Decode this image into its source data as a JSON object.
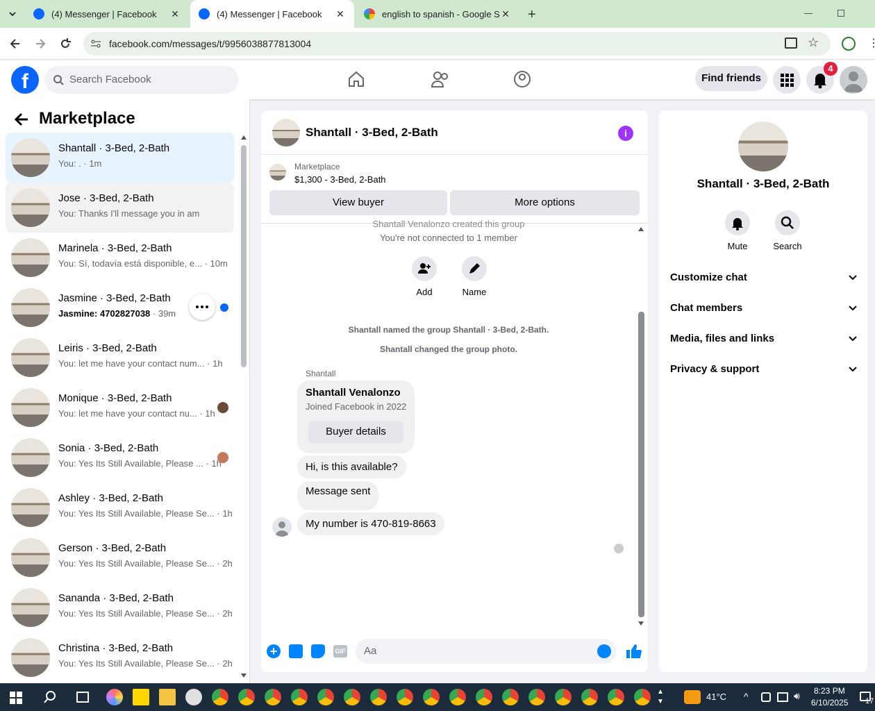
{
  "browser": {
    "tabs": [
      {
        "title": "(4) Messenger | Facebook",
        "active": false
      },
      {
        "title": "(4) Messenger | Facebook",
        "active": true
      },
      {
        "title": "english to spanish - Google Sea",
        "active": false
      }
    ],
    "url": "facebook.com/messages/t/9956038877813004"
  },
  "fb_header": {
    "search_placeholder": "Search Facebook",
    "find_friends": "Find friends",
    "notification_count": "4"
  },
  "sidebar": {
    "title": "Marketplace",
    "conversations": [
      {
        "name": "Shantall · 3-Bed, 2-Bath",
        "preview": "You: . · 1m",
        "selected": true
      },
      {
        "name": "Jose · 3-Bed, 2-Bath",
        "preview": "You: Thanks I'll message you in a",
        "time": "m"
      },
      {
        "name": "Marinela · 3-Bed, 2-Bath",
        "preview": "You: Sí, todavía está disponible, e...",
        "time": " · 10m"
      },
      {
        "name": "Jasmine · 3-Bed, 2-Bath",
        "preview": "Jasmine: 4702827038",
        "time": " · 39m",
        "unread": true
      },
      {
        "name": "Leiris · 3-Bed, 2-Bath",
        "preview": "You: let me have your contact num...",
        "time": " · 1h"
      },
      {
        "name": "Monique · 3-Bed, 2-Bath",
        "preview": "You: let me have your contact nu...",
        "time": " · 1h"
      },
      {
        "name": "Sonia · 3-Bed, 2-Bath",
        "preview": "You: Yes Its Still Available, Please ...",
        "time": " · 1h"
      },
      {
        "name": "Ashley · 3-Bed, 2-Bath",
        "preview": "You: Yes Its Still Available, Please Se...",
        "time": " · 1h"
      },
      {
        "name": "Gerson · 3-Bed, 2-Bath",
        "preview": "You: Yes Its Still Available, Please Se...",
        "time": " · 2h"
      },
      {
        "name": "Sananda · 3-Bed, 2-Bath",
        "preview": "You: Yes Its Still Available, Please Se...",
        "time": " · 2h"
      },
      {
        "name": "Christina · 3-Bed, 2-Bath",
        "preview": "You: Yes Its Still Available, Please Se...",
        "time": " · 2h"
      }
    ]
  },
  "chat": {
    "title": "Shantall · 3-Bed, 2-Bath",
    "listing_label": "Marketplace",
    "listing_detail": "$1,300 - 3-Bed, 2-Bath",
    "view_buyer": "View buyer",
    "more_options": "More options",
    "created_note": "Shantall Venalonzo created this group",
    "not_connected": "You're not connected to 1 member",
    "add_label": "Add",
    "name_label": "Name",
    "named_note": "Shantall named the group Shantall · 3-Bed, 2-Bath.",
    "photo_note": "Shantall changed the group photo.",
    "sender": "Shantall",
    "card_name": "Shantall Venalonzo",
    "card_joined": "Joined Facebook in 2022",
    "buyer_details": "Buyer details",
    "messages": [
      "Hi, is this available?",
      "Message sent",
      "My number is 470-819-8663"
    ],
    "composer_placeholder": "Aa"
  },
  "info_panel": {
    "title": "Shantall · 3-Bed, 2-Bath",
    "mute": "Mute",
    "search": "Search",
    "sections": [
      "Customize chat",
      "Chat members",
      "Media, files and links",
      "Privacy & support"
    ]
  },
  "taskbar": {
    "temperature": "41°C",
    "time": "8:23 PM",
    "date": "6/10/2025",
    "badge": "17"
  },
  "colors": {
    "fb_blue": "#0866ff",
    "messenger_blue": "#0084ff",
    "info_purple": "#a033ff",
    "tabstrip": "#cfe8cf",
    "notif_red": "#e41e3f"
  }
}
